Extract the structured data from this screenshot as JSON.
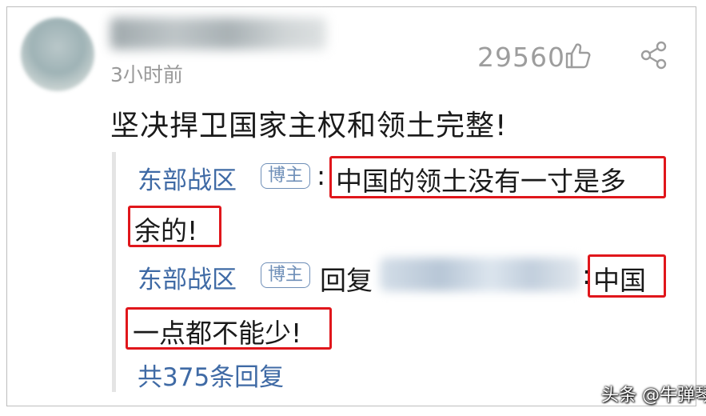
{
  "comment": {
    "time": "3小时前",
    "likes": "29560",
    "text": "坚决捍卫国家主权和领土完整!"
  },
  "replies": [
    {
      "author": "东部战区",
      "badge": "博主",
      "separator": ":",
      "text_line1": "中国的领土没有一寸是多",
      "text_line2": "余的!"
    },
    {
      "author": "东部战区",
      "badge": "博主",
      "reply_word": "回复",
      "separator": ":",
      "text_line1": "中国",
      "text_line2": "一点都不能少!"
    }
  ],
  "more_replies": "共375条回复",
  "watermark": "头条 @牛弹琴",
  "icons": [
    "like-icon",
    "share-icon",
    "wechat-icon"
  ],
  "colors": {
    "author": "#3f6aa5",
    "highlight": "#e0161b",
    "muted": "#9a9a9a"
  }
}
